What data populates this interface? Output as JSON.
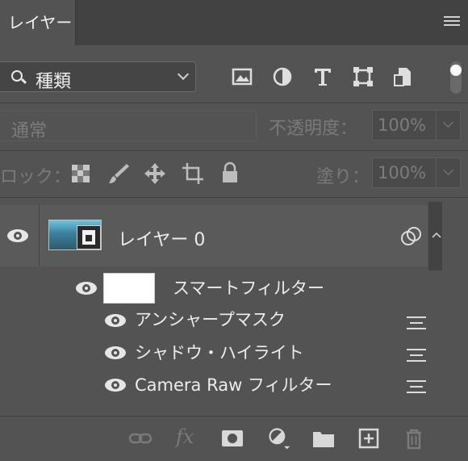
{
  "tab": {
    "label": "レイヤー"
  },
  "filter": {
    "kind_label": "種類",
    "icons": [
      "image-filter-icon",
      "adjustment-filter-icon",
      "type-filter-icon",
      "shape-filter-icon",
      "smart-object-filter-icon",
      "filter-toggle-icon"
    ]
  },
  "blend": {
    "mode": "通常",
    "opacity_label": "不透明度：",
    "opacity_value": "100%"
  },
  "lock": {
    "label": "ロック：",
    "icons": [
      "lock-transparent-pixels-icon",
      "lock-image-pixels-icon",
      "lock-position-icon",
      "lock-artboard-icon",
      "lock-all-icon"
    ],
    "fill_label": "塗り：",
    "fill_value": "100%"
  },
  "layers": {
    "layer0_name": "レイヤー 0",
    "smart_filters_label": "スマートフィルター",
    "filters": [
      "アンシャープマスク",
      "シャドウ・ハイライト",
      "Camera Raw フィルター"
    ]
  },
  "bottom": {
    "icons": [
      "link-layers-icon",
      "fx-icon",
      "add-mask-icon",
      "new-adjustment-layer-icon",
      "new-group-icon",
      "new-layer-icon",
      "delete-layer-icon"
    ],
    "fx_text": "fx"
  },
  "colors": {
    "panel": "#535353",
    "tabbar": "#424242",
    "selected_row": "#5a5a5a"
  }
}
